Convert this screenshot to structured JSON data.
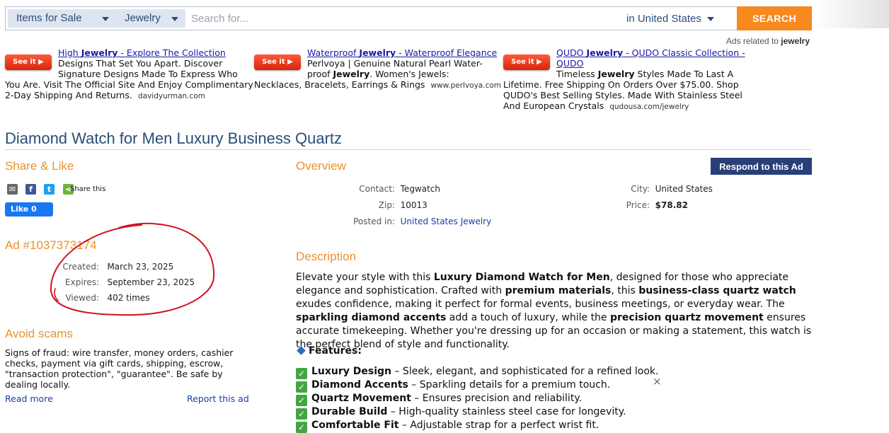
{
  "search": {
    "category": "Items for Sale",
    "subcategory": "Jewelry",
    "placeholder": "Search for...",
    "location": "in United States",
    "button": "SEARCH"
  },
  "ads": {
    "related_prefix": "Ads related to",
    "related_term": "jewelry",
    "see_it": "See it ▶",
    "items": [
      {
        "title_a": "High ",
        "title_b": "Jewelry",
        "title_c": " - Explore The Collection",
        "l1": "Designs That Set You Apart. Discover",
        "l2": "Signature Designs Made To Express Who",
        "l3": "You Are. Visit The Official Site And Enjoy Complimentary",
        "l4": "2-Day Shipping And Returns.",
        "domain": "davidyurman.com"
      },
      {
        "title_a": "Waterproof ",
        "title_b": "Jewelry",
        "title_c": " - Waterproof Elegance",
        "l1": "Perlvoya | Genuine Natural Pearl Water-",
        "l2a": "proof ",
        "l2b": "Jewelry",
        "l2c": ". Women's Jewels:",
        "l3": "Necklaces, Bracelets, Earrings & Rings",
        "domain": "www.perlvoya.com"
      },
      {
        "title_a": "QUDO ",
        "title_b": "Jewelry",
        "title_c": " - QUDO Classic Collection -",
        "title_d": "QUDO",
        "l1a": "Timeless ",
        "l1b": "Jewelry",
        "l1c": " Styles Made To Last A",
        "l2": "Lifetime. Free Shipping On Orders Over $75.00. Shop",
        "l3": "QUDO's Best Selling Styles. Made With Stainless Steel",
        "l4": "And European Crystals",
        "domain": "qudousa.com/jewelry"
      }
    ]
  },
  "listing": {
    "title": "Diamond Watch for Men Luxury Business Quartz",
    "share_heading": "Share & Like",
    "share_this": "Share this",
    "like": "Like 0",
    "ad_number": "Ad #1037373174",
    "created_label": "Created:",
    "created": "March 23, 2025",
    "expires_label": "Expires:",
    "expires": "September 23, 2025",
    "viewed_label": "Viewed:",
    "viewed": "402 times",
    "avoid_heading": "Avoid scams",
    "avoid_text": "Signs of fraud: wire transfer, money orders, cashier checks, payment via gift cards, shipping, escrow, \"transaction protection\", \"guarantee\". Be safe by dealing locally.",
    "read_more": "Read more",
    "report": "Report this ad"
  },
  "overview": {
    "heading": "Overview",
    "respond": "Respond to this Ad",
    "contact_label": "Contact:",
    "contact": "Tegwatch",
    "zip_label": "Zip:",
    "zip": "10013",
    "posted_label": "Posted in:",
    "posted": "United States Jewelry",
    "city_label": "City:",
    "city": "United States",
    "price_label": "Price:",
    "price": "$78.82"
  },
  "description": {
    "heading": "Description",
    "p": [
      "Elevate your style with this ",
      "Luxury Diamond Watch for Men",
      ", designed for those who appreciate elegance and sophistication. Crafted with ",
      "premium materials",
      ", this ",
      "business-class quartz watch",
      " exudes confidence, making it perfect for formal events, business meetings, or everyday wear. The ",
      "sparkling diamond accents",
      " add a touch of luxury, while the ",
      "precision quartz movement",
      " ensures accurate timekeeping. Whether you're dressing up for an occasion or making a statement, this watch is the perfect blend of style and functionality."
    ],
    "features_heading": "Features:",
    "features": [
      {
        "name": "Luxury Design",
        "text": " – Sleek, elegant, and sophisticated for a refined look."
      },
      {
        "name": "Diamond Accents",
        "text": " – Sparkling details for a premium touch."
      },
      {
        "name": "Quartz Movement",
        "text": " – Ensures precision and reliability."
      },
      {
        "name": "Durable Build",
        "text": " – High-quality stainless steel case for longevity."
      },
      {
        "name": "Comfortable Fit",
        "text": " – Adjustable strap for a perfect wrist fit."
      }
    ],
    "close": "×"
  },
  "colors": {
    "accent_orange": "#e8922c",
    "search_button": "#f7891f",
    "title_blue": "#2a4d7a",
    "link_blue": "#1a3fa6",
    "respond_button": "#2a3f78",
    "annotation_red": "#d0141e"
  }
}
